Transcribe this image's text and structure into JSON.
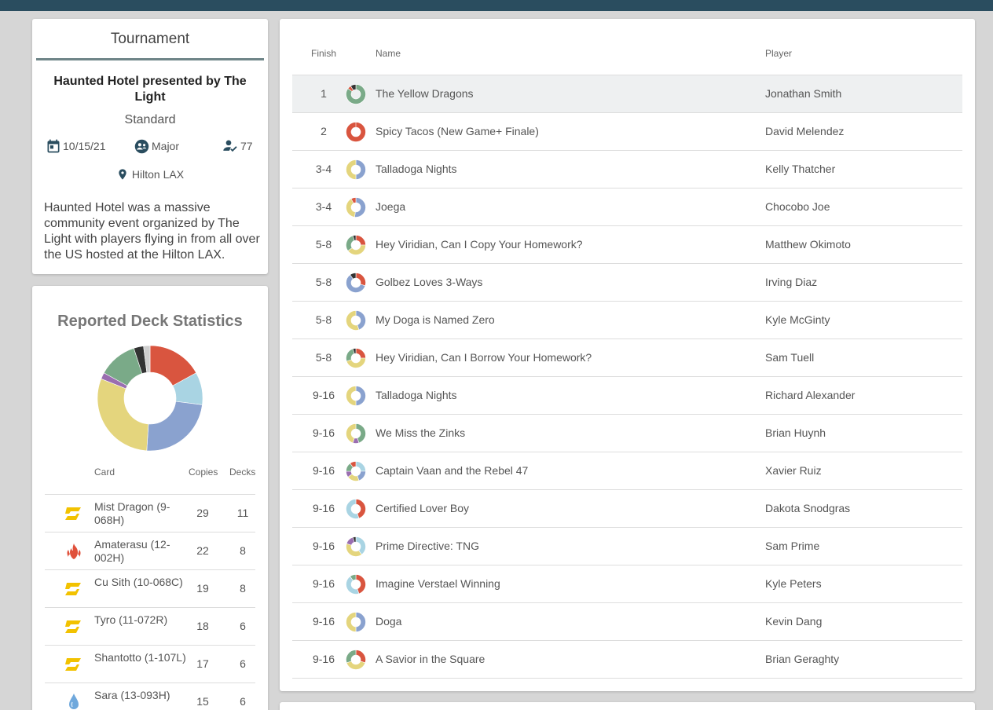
{
  "tournament": {
    "header": "Tournament",
    "name": "Haunted Hotel presented by The Light",
    "format": "Standard",
    "date": "10/15/21",
    "tier": "Major",
    "players": "77",
    "venue": "Hilton LAX",
    "description": "Haunted Hotel was a massive community event organized by The Light with players flying in from all over the US hosted at the Hilton LAX."
  },
  "stats": {
    "title": "Reported Deck Statistics",
    "columns": {
      "card": "Card",
      "copies": "Copies",
      "decks": "Decks"
    },
    "chart_data": {
      "type": "pie",
      "title": "",
      "slices": [
        {
          "color": "#d9553f",
          "value": 17
        },
        {
          "color": "#a9d4e3",
          "value": 10
        },
        {
          "color": "#8aa2cf",
          "value": 24
        },
        {
          "color": "#e4d57d",
          "value": 30
        },
        {
          "color": "#9a6eb0",
          "value": 2
        },
        {
          "color": "#7aaa88",
          "value": 12
        },
        {
          "color": "#333333",
          "value": 3
        },
        {
          "color": "#cfcfcf",
          "value": 2
        }
      ]
    },
    "rows": [
      {
        "card": "Mist Dragon (9-068H)",
        "copies": "29",
        "decks": "11",
        "icon": "lightning-element-icon"
      },
      {
        "card": "Amaterasu (12-002H)",
        "copies": "22",
        "decks": "8",
        "icon": "fire-element-icon"
      },
      {
        "card": "Cu Sith (10-068C)",
        "copies": "19",
        "decks": "8",
        "icon": "lightning-element-icon"
      },
      {
        "card": "Tyro (11-072R)",
        "copies": "18",
        "decks": "6",
        "icon": "lightning-element-icon"
      },
      {
        "card": "Shantotto (1-107L)",
        "copies": "17",
        "decks": "6",
        "icon": "lightning-element-icon"
      },
      {
        "card": "Sara (13-093H)",
        "copies": "15",
        "decks": "6",
        "icon": "water-element-icon"
      }
    ]
  },
  "results": {
    "columns": {
      "finish": "Finish",
      "name": "Name",
      "player": "Player"
    },
    "rows": [
      {
        "finish": "1",
        "name": "The Yellow Dragons",
        "player": "Jonathan Smith",
        "colors": [
          [
            "#7aaa88",
            85
          ],
          [
            "#d9553f",
            6
          ],
          [
            "#333333",
            9
          ]
        ]
      },
      {
        "finish": "2",
        "name": "Spicy Tacos (New Game+ Finale)",
        "player": "David Melendez",
        "colors": [
          [
            "#d9553f",
            100
          ]
        ]
      },
      {
        "finish": "3-4",
        "name": "Talladoga Nights",
        "player": "Kelly Thatcher",
        "colors": [
          [
            "#8aa2cf",
            50
          ],
          [
            "#e4d57d",
            50
          ]
        ]
      },
      {
        "finish": "3-4",
        "name": "Joega",
        "player": "Chocobo Joe",
        "colors": [
          [
            "#8aa2cf",
            52
          ],
          [
            "#e4d57d",
            40
          ],
          [
            "#d9553f",
            8
          ]
        ]
      },
      {
        "finish": "5-8",
        "name": "Hey Viridian, Can I Copy Your Homework?",
        "player": "Matthew Okimoto",
        "colors": [
          [
            "#d9553f",
            25
          ],
          [
            "#e4d57d",
            40
          ],
          [
            "#7aaa88",
            30
          ],
          [
            "#333333",
            5
          ]
        ]
      },
      {
        "finish": "5-8",
        "name": "Golbez Loves 3-Ways",
        "player": "Irving Diaz",
        "colors": [
          [
            "#d9553f",
            30
          ],
          [
            "#8aa2cf",
            60
          ],
          [
            "#333333",
            10
          ]
        ]
      },
      {
        "finish": "5-8",
        "name": "My Doga is Named Zero",
        "player": "Kyle McGinty",
        "colors": [
          [
            "#8aa2cf",
            45
          ],
          [
            "#e4d57d",
            55
          ]
        ]
      },
      {
        "finish": "5-8",
        "name": "Hey Viridian, Can I Borrow Your Homework?",
        "player": "Sam Tuell",
        "colors": [
          [
            "#d9553f",
            25
          ],
          [
            "#e4d57d",
            45
          ],
          [
            "#7aaa88",
            25
          ],
          [
            "#333333",
            5
          ]
        ]
      },
      {
        "finish": "9-16",
        "name": "Talladoga Nights",
        "player": "Richard Alexander",
        "colors": [
          [
            "#8aa2cf",
            50
          ],
          [
            "#e4d57d",
            50
          ]
        ]
      },
      {
        "finish": "9-16",
        "name": "We Miss the Zinks",
        "player": "Brian Huynh",
        "colors": [
          [
            "#7aaa88",
            45
          ],
          [
            "#9a6eb0",
            10
          ],
          [
            "#e4d57d",
            45
          ]
        ]
      },
      {
        "finish": "9-16",
        "name": "Captain Vaan and the Rebel 47",
        "player": "Xavier Ruiz",
        "colors": [
          [
            "#a9d4e3",
            25
          ],
          [
            "#8aa2cf",
            20
          ],
          [
            "#e4d57d",
            20
          ],
          [
            "#9a6eb0",
            10
          ],
          [
            "#7aaa88",
            15
          ],
          [
            "#d9553f",
            10
          ]
        ]
      },
      {
        "finish": "9-16",
        "name": "Certified Lover Boy",
        "player": "Dakota Snodgras",
        "colors": [
          [
            "#d9553f",
            45
          ],
          [
            "#a9d4e3",
            55
          ]
        ]
      },
      {
        "finish": "9-16",
        "name": "Prime Directive: TNG",
        "player": "Sam Prime",
        "colors": [
          [
            "#a9d4e3",
            40
          ],
          [
            "#e4d57d",
            40
          ],
          [
            "#9a6eb0",
            15
          ],
          [
            "#333333",
            5
          ]
        ]
      },
      {
        "finish": "9-16",
        "name": "Imagine Verstael Winning",
        "player": "Kyle Peters",
        "colors": [
          [
            "#d9553f",
            45
          ],
          [
            "#a9d4e3",
            45
          ],
          [
            "#7aaa88",
            10
          ]
        ]
      },
      {
        "finish": "9-16",
        "name": "Doga",
        "player": "Kevin Dang",
        "colors": [
          [
            "#8aa2cf",
            50
          ],
          [
            "#e4d57d",
            50
          ]
        ]
      },
      {
        "finish": "9-16",
        "name": "A Savior in the Square",
        "player": "Brian Geraghty",
        "colors": [
          [
            "#d9553f",
            30
          ],
          [
            "#e4d57d",
            40
          ],
          [
            "#7aaa88",
            30
          ]
        ]
      }
    ]
  }
}
